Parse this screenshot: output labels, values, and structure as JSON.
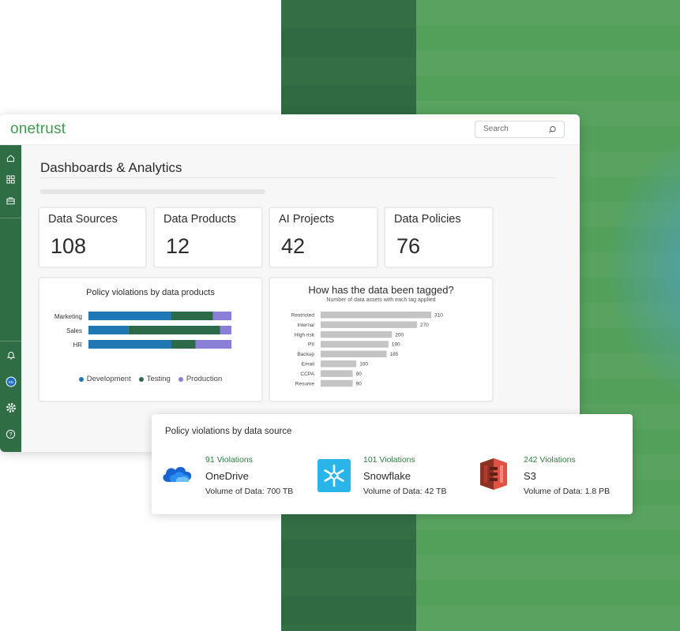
{
  "app": {
    "logo": "onetrust",
    "search_placeholder": "Search"
  },
  "page": {
    "title": "Dashboards & Analytics"
  },
  "sidebar": {
    "top_icons": [
      "home-icon",
      "grid-icon",
      "briefcase-icon"
    ],
    "bottom_icons": [
      "bell-icon",
      "avatar",
      "gear-icon",
      "help-icon"
    ],
    "avatar_initials": "KB"
  },
  "kpis": [
    {
      "label": "Data Sources",
      "value": "108"
    },
    {
      "label": "Data Products",
      "value": "12"
    },
    {
      "label": "AI Projects",
      "value": "42"
    },
    {
      "label": "Data Policies",
      "value": "76"
    }
  ],
  "colors": {
    "brand": "#3d9a4f",
    "sidebar": "#2f6e45",
    "development": "#1f77b4",
    "testing": "#2d6a4a",
    "production": "#8a7fd6",
    "tag_bar": "#c4c4c4"
  },
  "chart_data": [
    {
      "type": "bar",
      "orientation": "horizontal",
      "stacked": true,
      "title": "Policy violations by data products",
      "categories": [
        "Marketing",
        "Sales",
        "HR"
      ],
      "series": [
        {
          "name": "Development",
          "values": [
            58,
            28,
            58
          ]
        },
        {
          "name": "Testing",
          "values": [
            29,
            64,
            17
          ]
        },
        {
          "name": "Production",
          "values": [
            13,
            8,
            25
          ]
        }
      ],
      "legend": "bottom"
    },
    {
      "type": "bar",
      "orientation": "horizontal",
      "title": "How has the data been tagged?",
      "subtitle": "Number of data assets with each tag applied",
      "categories": [
        "Restricted",
        "Internal",
        "High risk",
        "PII",
        "Backup",
        "Email",
        "CCPA",
        "Resume"
      ],
      "values": [
        310,
        270,
        200,
        190,
        185,
        100,
        90,
        90
      ],
      "value_labels": [
        "310",
        "270",
        "200",
        "190",
        "185",
        "100",
        "90",
        "90"
      ]
    }
  ],
  "violations_panel": {
    "title": "Policy violations by data source",
    "sources": [
      {
        "violations": "91 Violations",
        "name": "OneDrive",
        "volume": "Volume of Data: 700 TB",
        "icon": "onedrive-icon"
      },
      {
        "violations": "101 Violations",
        "name": "Snowflake",
        "volume": "Volume of Data: 42 TB",
        "icon": "snowflake-icon"
      },
      {
        "violations": "242 Violations",
        "name": "S3",
        "volume": "Volume of Data: 1.8 PB",
        "icon": "s3-icon"
      }
    ]
  }
}
